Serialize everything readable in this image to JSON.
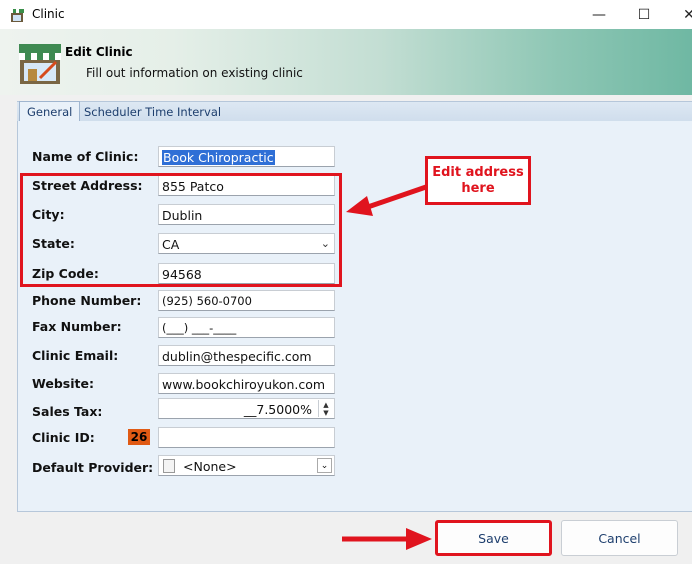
{
  "window": {
    "title": "Clinic",
    "minimize_glyph": "—",
    "maximize_glyph": "☐",
    "close_glyph": "✕"
  },
  "header": {
    "title": "Edit Clinic",
    "subtitle": "Fill out information on existing clinic",
    "icon": "storefront-icon"
  },
  "tabs": [
    {
      "label": "General",
      "active": true
    },
    {
      "label": "Scheduler Time Interval",
      "active": false
    }
  ],
  "form": {
    "name_label": "Name of Clinic:",
    "name_value": "Book Chiropractic",
    "street_label": "Street Address:",
    "street_value": "855 Patco",
    "city_label": "City:",
    "city_value": "Dublin",
    "state_label": "State:",
    "state_value": "CA",
    "zip_label": "Zip Code:",
    "zip_value": "94568",
    "phone_label": "Phone Number:",
    "phone_value": "(925) 560-0700",
    "fax_label": "Fax Number:",
    "fax_value": "(___) ___-____",
    "email_label": "Clinic Email:",
    "email_value": "dublin@thespecific.com",
    "website_label": "Website:",
    "website_value": "www.bookchiroyukon.com",
    "tax_label": "Sales Tax:",
    "tax_value": "__7.5000%",
    "clinic_id_label": "Clinic ID:",
    "clinic_id_badge": "26",
    "clinic_id_value": "",
    "provider_label": "Default Provider:",
    "provider_value": "<None>"
  },
  "annotation": {
    "callout_text": "Edit address here",
    "color": "#e0141e"
  },
  "buttons": {
    "save": "Save",
    "cancel": "Cancel"
  }
}
